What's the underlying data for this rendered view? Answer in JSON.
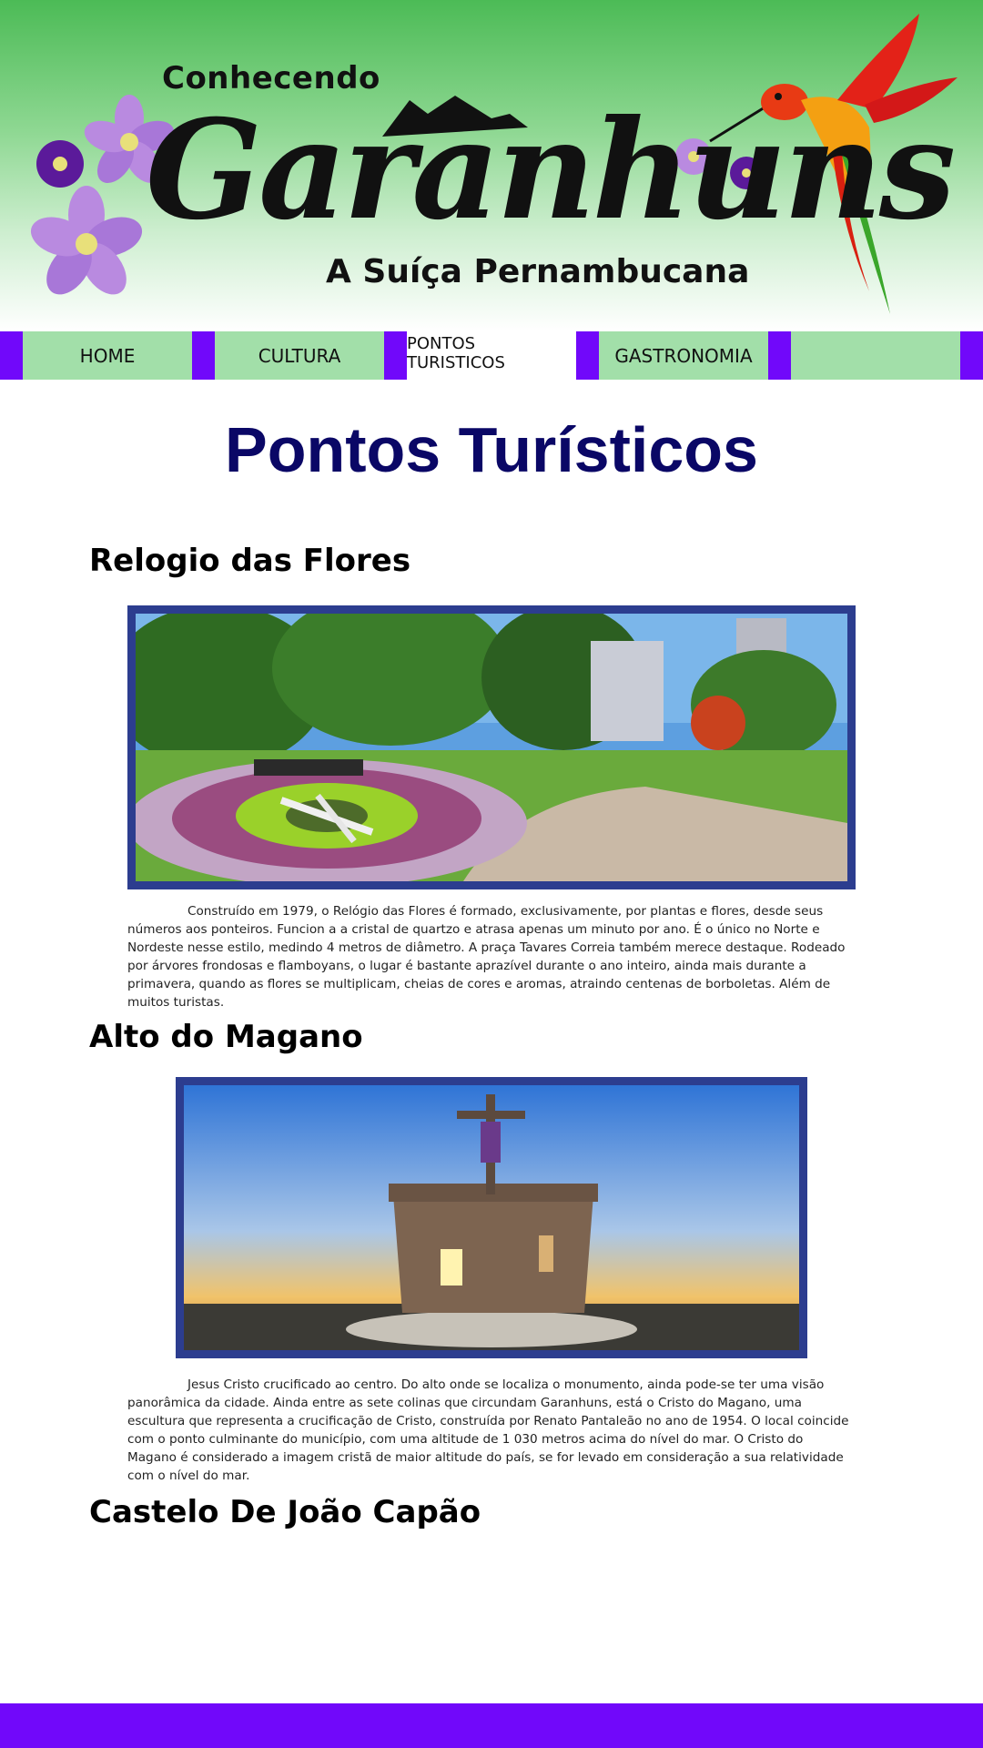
{
  "banner": {
    "logo_small": "Conhecendo",
    "logo_big": "Garanhuns",
    "logo_sub": "A Suíça Pernambucana"
  },
  "nav": {
    "items": [
      {
        "label": "HOME"
      },
      {
        "label": "CULTURA"
      },
      {
        "label": "PONTOS TURISTICOS",
        "active": true
      },
      {
        "label": "GASTRONOMIA"
      },
      {
        "label": ""
      }
    ]
  },
  "main": {
    "title": "Pontos Turísticos",
    "sections": [
      {
        "title": "Relogio das Flores",
        "image_icon": "flower-clock-photo",
        "text": "Construído em 1979, o Relógio das Flores é formado, exclusivamente, por plantas e flores, desde seus números aos ponteiros. Funcion a a cristal de quartzo e atrasa apenas um minuto por ano. É o único no Norte e Nordeste nesse estilo, medindo 4 metros de diâmetro. A praça Tavares Correia também merece destaque. Rodeado por árvores frondosas e flamboyans, o lugar é bastante aprazível durante o ano inteiro, ainda mais durante a primavera, quando as flores se multiplicam, cheias de cores e aromas, atraindo centenas de borboletas. Além de muitos turistas."
      },
      {
        "title": "Alto do Magano",
        "image_icon": "cristo-do-magano-photo",
        "text": "Jesus Cristo crucificado ao centro. Do alto onde se localiza o monumento, ainda pode-se ter uma visão panorâmica da cidade. Ainda entre as sete colinas que circundam Garanhuns, está o Cristo do Magano, uma escultura que representa a crucificação de Cristo, construída por Renato Pantaleão no ano de 1954. O local coincide com o ponto culminante do município, com uma altitude de 1 030 metros acima do nível do mar. O Cristo do Magano é considerado a imagem cristã de maior altitude do país, se for levado em consideração a sua relatividade com o nível do mar."
      },
      {
        "title": "Castelo De João Capão"
      }
    ]
  },
  "colors": {
    "nav_bar": "#7108fa",
    "nav_item": "#a2dfa9",
    "title": "#0a0766",
    "photo_border": "#2c3d8f"
  }
}
